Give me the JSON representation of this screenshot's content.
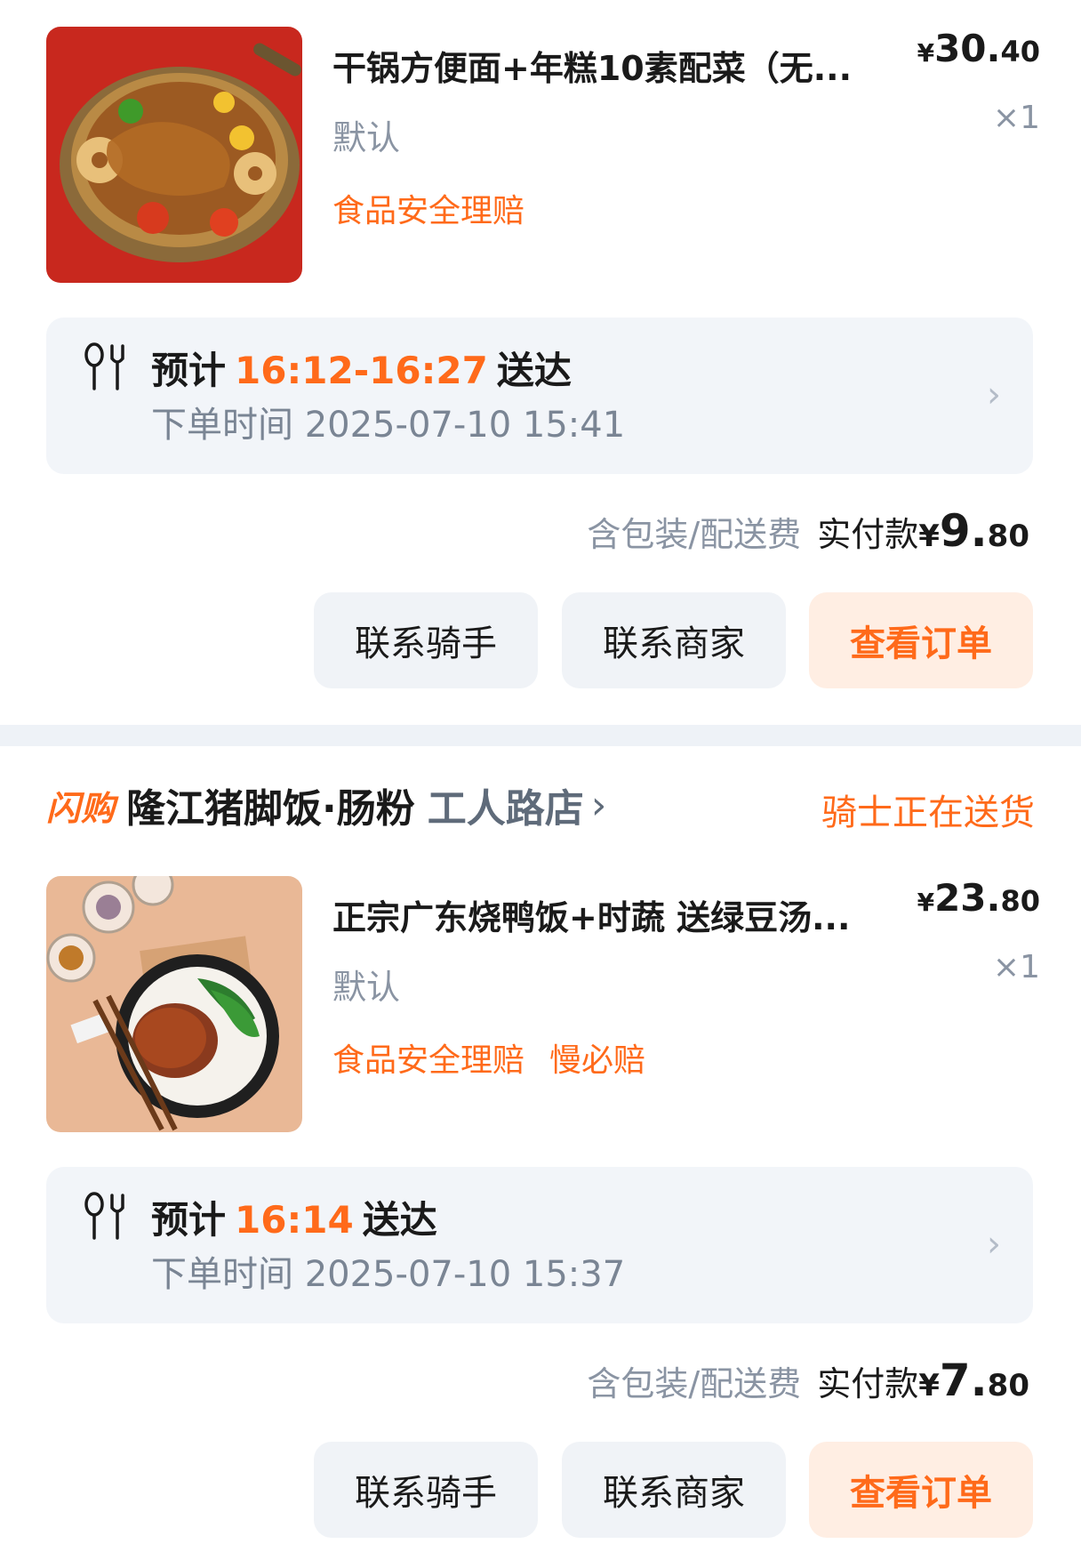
{
  "orders": [
    {
      "item": {
        "name": "干锅方便面+年糕10素配菜（无...",
        "price_currency": "¥",
        "price_int": "30.",
        "price_dec": "40",
        "qty": "×1",
        "spec": "默认",
        "tags": [
          "食品安全理赔"
        ]
      },
      "eta": {
        "prefix": "预计",
        "time": "16:12-16:27",
        "suffix": "送达",
        "order_time": "下单时间 2025-07-10 15:41"
      },
      "payment": {
        "fee_note": "含包装/配送费",
        "label": "实付款",
        "currency": "¥",
        "int": "9.",
        "dec": "80"
      },
      "buttons": {
        "contact_rider": "联系骑手",
        "contact_merchant": "联系商家",
        "view_order": "查看订单"
      }
    },
    {
      "shop": {
        "brand": "闪购",
        "name": "隆江猪脚饭·肠粉",
        "branch": "工人路店",
        "status": "骑士正在送货"
      },
      "item": {
        "name": "正宗广东烧鸭饭+时蔬  送绿豆汤...",
        "price_currency": "¥",
        "price_int": "23.",
        "price_dec": "80",
        "qty": "×1",
        "spec": "默认",
        "tags": [
          "食品安全理赔",
          "慢必赔"
        ]
      },
      "eta": {
        "prefix": "预计",
        "time": "16:14",
        "suffix": "送达",
        "order_time": "下单时间 2025-07-10 15:37"
      },
      "payment": {
        "fee_note": "含包装/配送费",
        "label": "实付款",
        "currency": "¥",
        "int": "7.",
        "dec": "80"
      },
      "buttons": {
        "contact_rider": "联系骑手",
        "contact_merchant": "联系商家",
        "view_order": "查看订单"
      }
    }
  ],
  "colors": {
    "accent": "#ff6a1a",
    "muted": "#8a94a3",
    "panel": "#f2f5f9"
  },
  "icons": {
    "eta": "fork-spoon-icon",
    "chevron": "chevron-right-icon"
  }
}
